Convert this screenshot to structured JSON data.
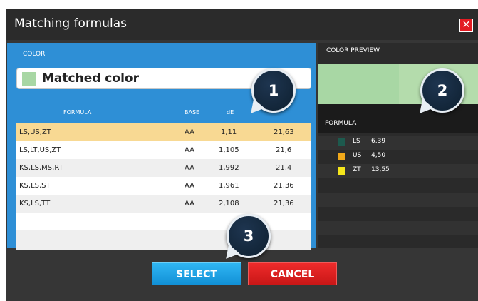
{
  "dialog": {
    "title": "Matching formulas",
    "close_icon": "close-icon"
  },
  "color_section": {
    "label": "COLOR",
    "matched_name": "Matched color",
    "swatch_color": "#a8d7a4"
  },
  "table": {
    "headers": [
      "FORMULA",
      "BASE",
      "dE",
      ""
    ],
    "rows": [
      {
        "formula": "LS,US,ZT",
        "base": "AA",
        "de": "1,11",
        "value": "21,63",
        "selected": true
      },
      {
        "formula": "LS,LT,US,ZT",
        "base": "AA",
        "de": "1,105",
        "value": "21,6",
        "selected": false
      },
      {
        "formula": "KS,LS,MS,RT",
        "base": "AA",
        "de": "1,992",
        "value": "21,4",
        "selected": false
      },
      {
        "formula": "KS,LS,ST",
        "base": "AA",
        "de": "1,961",
        "value": "21,36",
        "selected": false
      },
      {
        "formula": "KS,LS,TT",
        "base": "AA",
        "de": "2,108",
        "value": "21,36",
        "selected": false
      }
    ]
  },
  "preview": {
    "label": "COLOR PREVIEW",
    "color": "#a8d7a4"
  },
  "formula_panel": {
    "label": "FORMULA",
    "items": [
      {
        "code": "LS",
        "amount": "6,39",
        "color": "#1d5a4e"
      },
      {
        "code": "US",
        "amount": "4,50",
        "color": "#f0a81a"
      },
      {
        "code": "ZT",
        "amount": "13,55",
        "color": "#f5e61b"
      }
    ]
  },
  "buttons": {
    "select": "SELECT",
    "cancel": "CANCEL"
  },
  "callouts": [
    "1",
    "2",
    "3"
  ]
}
